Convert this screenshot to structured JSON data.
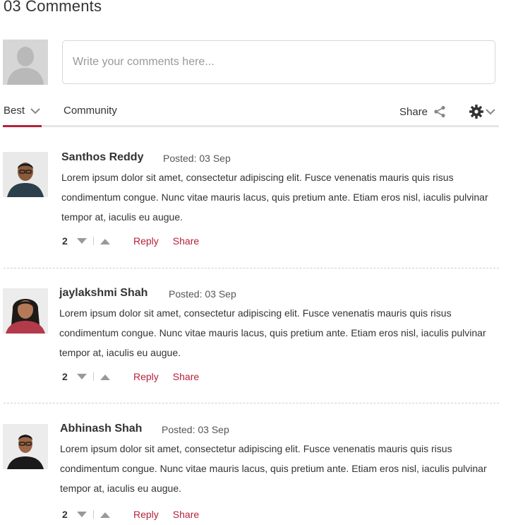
{
  "header": {
    "title": "03 Comments"
  },
  "composer": {
    "placeholder": "Write your comments here..."
  },
  "tabs": {
    "best_label": "Best",
    "community_label": "Community",
    "share_label": "Share"
  },
  "comments": [
    {
      "author": "Santhos Reddy",
      "posted": "Posted: 03 Sep",
      "body": "Lorem ipsum dolor sit amet, consectetur adipiscing elit. Fusce venenatis mauris quis risus condimentum congue. Nunc vitae mauris lacus, quis pretium ante. Etiam eros nisl, iaculis pulvinar tempor at, iaculis eu augue.",
      "votes": "2",
      "reply_label": "Reply",
      "share_label": "Share"
    },
    {
      "author": "jaylakshmi Shah",
      "posted": "Posted: 03 Sep",
      "body": "Lorem ipsum dolor sit amet, consectetur adipiscing elit. Fusce venenatis mauris quis risus condimentum congue. Nunc vitae mauris lacus, quis pretium ante. Etiam eros nisl, iaculis pulvinar tempor at, iaculis eu augue.",
      "votes": "2",
      "reply_label": "Reply",
      "share_label": "Share"
    },
    {
      "author": "Abhinash Shah",
      "posted": "Posted: 03 Sep",
      "body": "Lorem ipsum dolor sit amet, consectetur adipiscing elit. Fusce venenatis mauris quis risus condimentum congue. Nunc vitae mauris lacus, quis pretium ante. Etiam eros nisl, iaculis pulvinar tempor at, iaculis eu augue.",
      "votes": "2",
      "reply_label": "Reply",
      "share_label": "Share"
    }
  ],
  "colors": {
    "accent": "#b5223a",
    "text": "#333333",
    "muted": "#999999"
  },
  "icons": [
    "avatar-placeholder",
    "chevron-down-icon",
    "share-icon",
    "gear-icon",
    "vote-down-icon",
    "vote-up-icon"
  ]
}
